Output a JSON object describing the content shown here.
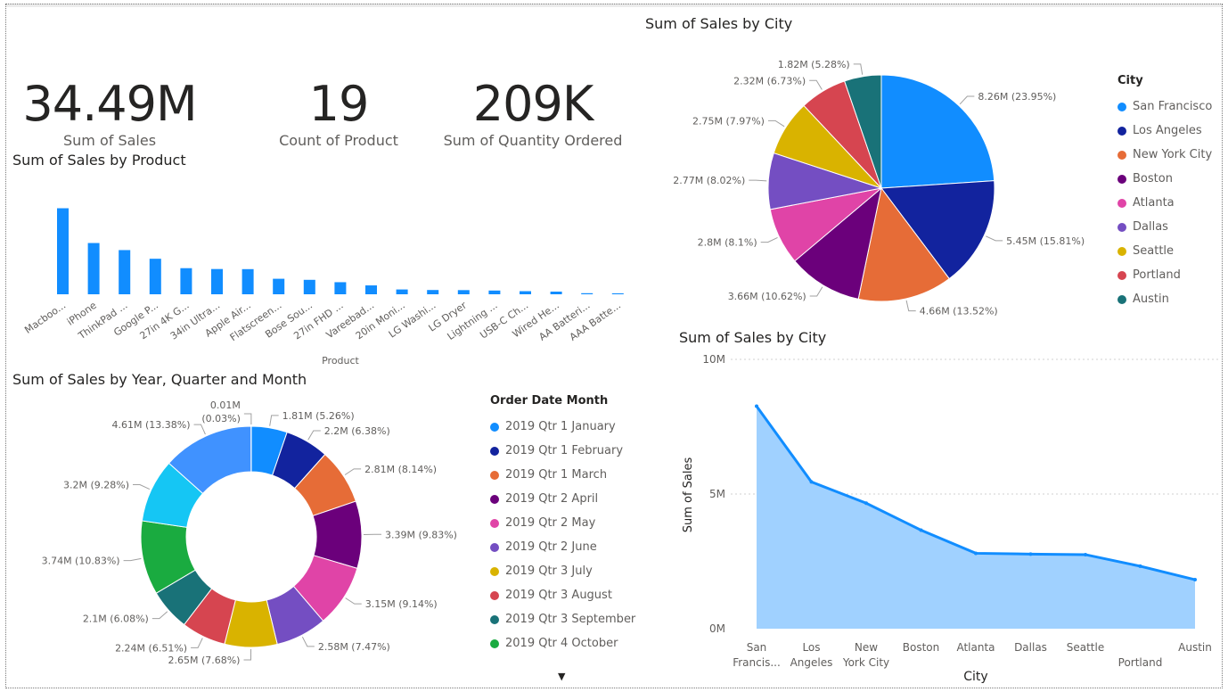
{
  "kpis": [
    {
      "value": "34.49M",
      "label": "Sum of Sales"
    },
    {
      "value": "19",
      "label": "Count of Product"
    },
    {
      "value": "209K",
      "label": "Sum of Quantity Ordered"
    }
  ],
  "colors": {
    "primary": "#118DFF",
    "area_fill": "#A0D1FF",
    "text": "#252423",
    "muted": "#605e5c"
  },
  "chart_data": [
    {
      "id": "product-bar",
      "type": "bar",
      "title": "Sum of Sales by Product",
      "xlabel": "Product",
      "ylabel": "",
      "categories": [
        "Macboo...",
        "iPhone",
        "ThinkPad ...",
        "Google P...",
        "27in 4K G...",
        "34in Ultra...",
        "Apple Air...",
        "Flatscreen...",
        "Bose Sou...",
        "27in FHD ...",
        "Vareebad...",
        "20in Moni...",
        "LG Washi...",
        "LG Dryer",
        "Lightning ...",
        "USB-C Ch...",
        "Wired He...",
        "AA Batteri...",
        "AAA Batte..."
      ],
      "values": [
        8.04,
        4.79,
        4.13,
        3.32,
        2.44,
        2.36,
        2.35,
        1.45,
        1.35,
        1.13,
        0.83,
        0.45,
        0.4,
        0.39,
        0.35,
        0.29,
        0.25,
        0.1,
        0.09
      ],
      "ylim": [
        0,
        9
      ],
      "color": "#118DFF"
    },
    {
      "id": "city-pie",
      "type": "pie",
      "title": "Sum of Sales by City",
      "legend_title": "City",
      "legend_position": "right",
      "slices": [
        {
          "label": "San Francisco",
          "value": 8.26,
          "text": "8.26M (23.95%)",
          "color": "#118DFF"
        },
        {
          "label": "Los Angeles",
          "value": 5.45,
          "text": "5.45M (15.81%)",
          "color": "#12239E"
        },
        {
          "label": "New York City",
          "value": 4.66,
          "text": "4.66M (13.52%)",
          "color": "#E66C37"
        },
        {
          "label": "Boston",
          "value": 3.66,
          "text": "3.66M (10.62%)",
          "color": "#6B007B"
        },
        {
          "label": "Atlanta",
          "value": 2.8,
          "text": "2.8M (8.1%)",
          "color": "#E044A7"
        },
        {
          "label": "Dallas",
          "value": 2.77,
          "text": "2.77M (8.02%)",
          "color": "#744EC2"
        },
        {
          "label": "Seattle",
          "value": 2.75,
          "text": "2.75M (7.97%)",
          "color": "#D9B300"
        },
        {
          "label": "Portland",
          "value": 2.32,
          "text": "2.32M (6.73%)",
          "color": "#D64550"
        },
        {
          "label": "Austin",
          "value": 1.82,
          "text": "1.82M (5.28%)",
          "color": "#197278"
        }
      ]
    },
    {
      "id": "month-donut",
      "type": "pie",
      "title": "Sum of Sales by Year, Quarter and Month",
      "legend_title": "Order Date Month",
      "legend_position": "right",
      "slices": [
        {
          "label": "2019 Qtr 1 January",
          "value": 1.81,
          "text": "1.81M (5.26%)",
          "color": "#118DFF"
        },
        {
          "label": "2019 Qtr 1 February",
          "value": 2.2,
          "text": "2.2M (6.38%)",
          "color": "#12239E"
        },
        {
          "label": "2019 Qtr 1 March",
          "value": 2.81,
          "text": "2.81M (8.14%)",
          "color": "#E66C37"
        },
        {
          "label": "2019 Qtr 2 April",
          "value": 3.39,
          "text": "3.39M (9.83%)",
          "color": "#6B007B"
        },
        {
          "label": "2019 Qtr 2 May",
          "value": 3.15,
          "text": "3.15M (9.14%)",
          "color": "#E044A7"
        },
        {
          "label": "2019 Qtr 2 June",
          "value": 2.58,
          "text": "2.58M (7.47%)",
          "color": "#744EC2"
        },
        {
          "label": "2019 Qtr 3 July",
          "value": 2.65,
          "text": "2.65M (7.68%)",
          "color": "#D9B300"
        },
        {
          "label": "2019 Qtr 3 August",
          "value": 2.24,
          "text": "2.24M (6.51%)",
          "color": "#D64550"
        },
        {
          "label": "2019 Qtr 3 September",
          "value": 2.1,
          "text": "2.1M (6.08%)",
          "color": "#197278"
        },
        {
          "label": "2019 Qtr 4 October",
          "value": 3.74,
          "text": "3.74M (10.83%)",
          "color": "#1AAB40"
        },
        {
          "label": "",
          "value": 3.2,
          "text": "3.2M (9.28%)",
          "color": "#15C6F4"
        },
        {
          "label": "",
          "value": 4.61,
          "text": "4.61M (13.38%)",
          "color": "#4092FF"
        },
        {
          "label": "",
          "value": 0.01,
          "text_lines": [
            "0.01M",
            "(0.03%)"
          ],
          "color": "#FFA058"
        }
      ]
    },
    {
      "id": "city-area",
      "type": "area",
      "title": "Sum of Sales by City",
      "xlabel": "City",
      "ylabel": "Sum of Sales",
      "categories": [
        [
          "San",
          "Francis..."
        ],
        [
          "Los",
          "Angeles"
        ],
        [
          "New",
          "York City"
        ],
        [
          "Boston"
        ],
        [
          "Atlanta"
        ],
        [
          "Dallas"
        ],
        [
          "Seattle"
        ],
        [
          "",
          "Portland"
        ],
        [
          "Austin"
        ]
      ],
      "values": [
        8.26,
        5.45,
        4.66,
        3.66,
        2.8,
        2.77,
        2.75,
        2.32,
        1.82
      ],
      "yticks": [
        "0M",
        "5M",
        "10M"
      ],
      "ylim": [
        0,
        10
      ],
      "grid": true
    }
  ]
}
